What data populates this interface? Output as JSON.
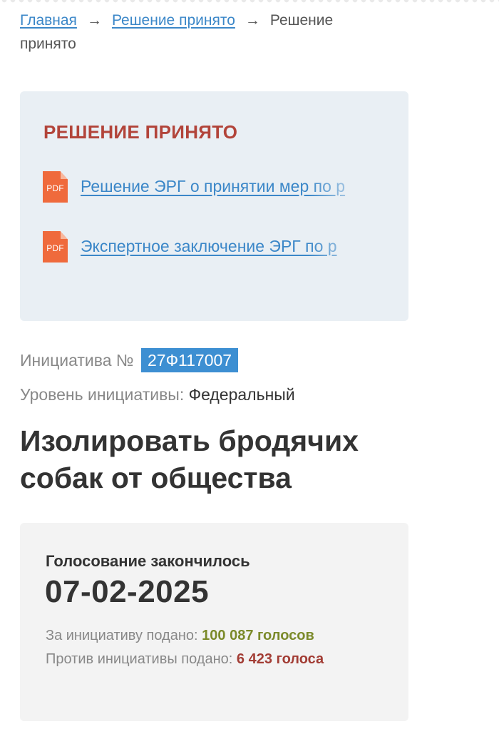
{
  "breadcrumb": {
    "home": "Главная",
    "section": "Решение принято",
    "current": "Решение принято",
    "separator": "→"
  },
  "decision": {
    "title": "РЕШЕНИЕ ПРИНЯТО",
    "documents": [
      {
        "icon": "pdf-icon",
        "icon_text": "PDF",
        "label": "Решение ЭРГ о принятии мер по р"
      },
      {
        "icon": "pdf-icon",
        "icon_text": "PDF",
        "label": "Экспертное заключение ЭРГ по р"
      }
    ]
  },
  "initiative": {
    "number_label": "Инициатива №",
    "number": "27Ф117007",
    "level_label": "Уровень инициативы:",
    "level": "Федеральный",
    "title": "Изолировать бродячих собак от общества"
  },
  "voting": {
    "status": "Голосование закончилось",
    "date": "07-02-2025",
    "for_label": "За инициативу подано:",
    "for_count": "100 087 голосов",
    "against_label": "Против инициативы подано:",
    "against_count": "6 423 голоса"
  },
  "colors": {
    "link": "#3b87c8",
    "decision_title": "#b2443a",
    "pdf_icon": "#ef6a3c",
    "number_badge": "#3d8fd2",
    "votes_for": "#7b8a2a",
    "votes_against": "#a23c34"
  }
}
